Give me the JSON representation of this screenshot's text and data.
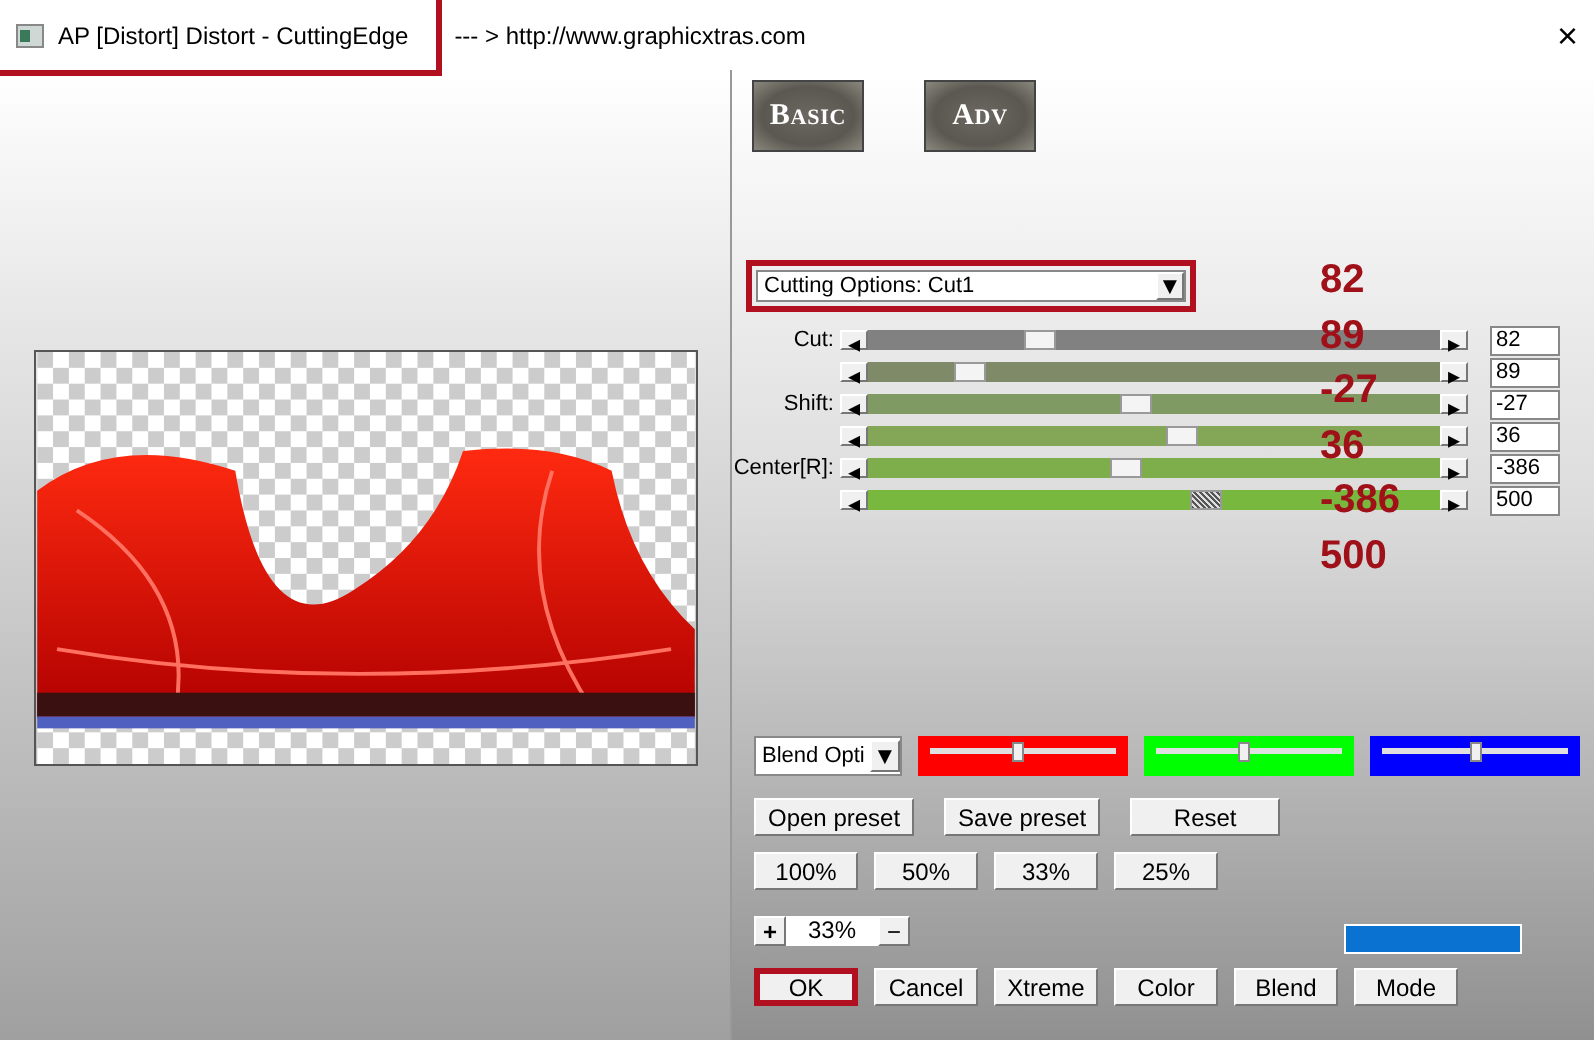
{
  "window": {
    "title": "AP [Distort]  Distort - CuttingEdge",
    "url": "--- > http://www.graphicxtras.com",
    "close": "×"
  },
  "mode_buttons": [
    {
      "label": "Basic"
    },
    {
      "label": "Adv"
    }
  ],
  "cutting_dropdown": {
    "value": "Cutting Options: Cut1",
    "arrow": "▼"
  },
  "sliders": [
    {
      "label": "Cut:",
      "level": 0.3,
      "value": "82",
      "color": "#818181"
    },
    {
      "level": 0.18,
      "value": "89",
      "color": "#7e8a68"
    },
    {
      "label": "Shift:",
      "level": 0.47,
      "value": "-27",
      "color": "#7f9a62"
    },
    {
      "level": 0.55,
      "value": "36",
      "color": "#83a757"
    },
    {
      "label": "Center[R]:",
      "level": 0.45,
      "value": "-386",
      "color": "#7eae4c"
    },
    {
      "level": 0.59,
      "value": "500",
      "color": "#79b83f"
    }
  ],
  "slider_arrows": {
    "left": "◂",
    "right": "▸"
  },
  "annotations": [
    "82",
    "89",
    "-27",
    "36",
    "-386",
    "500"
  ],
  "blend_dropdown": {
    "value": "Blend Opti",
    "arrow": "▼"
  },
  "color_sliders": [
    {
      "color": "#ff0000",
      "level": 0.47
    },
    {
      "color": "#00ff00",
      "level": 0.47
    },
    {
      "color": "#0000ff",
      "level": 0.5
    }
  ],
  "preset_buttons": [
    "Open preset",
    "Save preset",
    "Reset"
  ],
  "zoom_buttons": [
    "100%",
    "50%",
    "33%",
    "25%"
  ],
  "zoom_stepper": {
    "plus": "+",
    "value": "33%",
    "minus": "−"
  },
  "status_bar": {
    "color": "#0a73d2"
  },
  "action_buttons": [
    {
      "label": "OK",
      "highlighted": true
    },
    {
      "label": "Cancel",
      "highlighted": false
    },
    {
      "label": "Xtreme",
      "highlighted": false
    },
    {
      "label": "Color",
      "highlighted": false
    },
    {
      "label": "Blend",
      "highlighted": false
    },
    {
      "label": "Mode",
      "highlighted": false
    }
  ]
}
